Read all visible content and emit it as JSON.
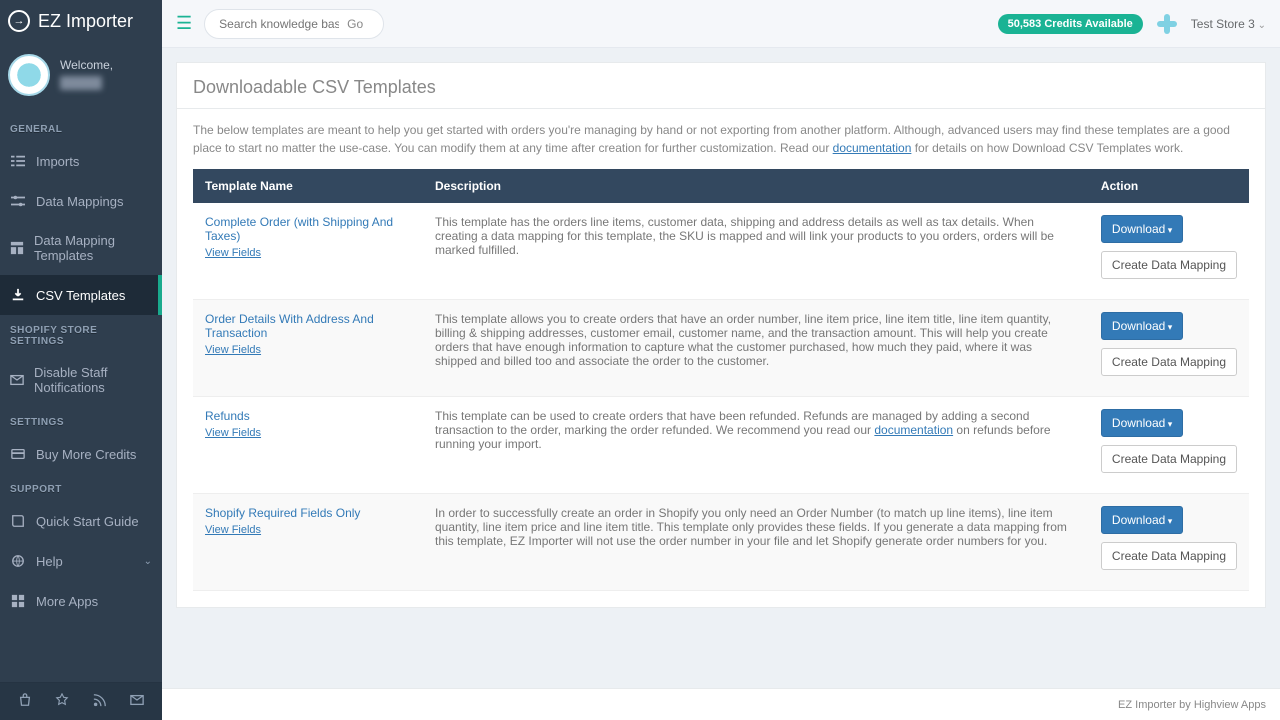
{
  "brand": {
    "name": "EZ Importer"
  },
  "welcome": {
    "label": "Welcome,"
  },
  "nav": {
    "headings": {
      "general": "GENERAL",
      "shopify": "SHOPIFY STORE SETTINGS",
      "settings": "SETTINGS",
      "support": "SUPPORT"
    },
    "items": {
      "imports": "Imports",
      "data_mappings": "Data Mappings",
      "data_mapping_templates": "Data Mapping Templates",
      "csv_templates": "CSV Templates",
      "disable_staff": "Disable Staff Notifications",
      "buy_credits": "Buy More Credits",
      "quick_start": "Quick Start Guide",
      "help": "Help",
      "more_apps": "More Apps"
    }
  },
  "topbar": {
    "search_placeholder": "Search knowledge base...",
    "go": "Go",
    "credits": "50,583 Credits Available",
    "store": "Test Store 3"
  },
  "page": {
    "title": "Downloadable CSV Templates",
    "intro_before": "The below templates are meant to help you get started with orders you're managing by hand or not exporting from another platform. Although, advanced users may find these templates are a good place to start no matter the use-case. You can modify them at any time after creation for further customization. Read our ",
    "intro_link": "documentation",
    "intro_after": " for details on how Download CSV Templates work."
  },
  "table": {
    "headers": {
      "name": "Template Name",
      "desc": "Description",
      "action": "Action"
    },
    "view_fields": "View Fields",
    "download": "Download",
    "create_mapping": "Create Data Mapping",
    "rows": [
      {
        "name": "Complete Order (with Shipping And Taxes)",
        "desc": "This template has the orders line items, customer data, shipping and address details as well as tax details. When creating a data mapping for this template, the SKU is mapped and will link your products to you orders, orders will be marked fulfilled."
      },
      {
        "name": "Order Details With Address And Transaction",
        "desc": "This template allows you to create orders that have an order number, line item price, line item title, line item quantity, billing & shipping addresses, customer email, customer name, and the transaction amount. This will help you create orders that have enough information to capture what the customer purchased, how much they paid, where it was shipped and billed too and associate the order to the customer."
      },
      {
        "name": "Refunds",
        "desc_before": "This template can be used to create orders that have been refunded. Refunds are managed by adding a second transaction to the order, marking the order refunded. We recommend you read our ",
        "desc_link": "documentation",
        "desc_after": " on refunds before running your import."
      },
      {
        "name": "Shopify Required Fields Only",
        "desc": "In order to successfully create an order in Shopify you only need an Order Number (to match up line items), line item quantity, line item price and line item title. This template only provides these fields. If you generate a data mapping from this template, EZ Importer will not use the order number in your file and let Shopify generate order numbers for you."
      }
    ]
  },
  "footer": {
    "text": "EZ Importer by Highview Apps"
  }
}
